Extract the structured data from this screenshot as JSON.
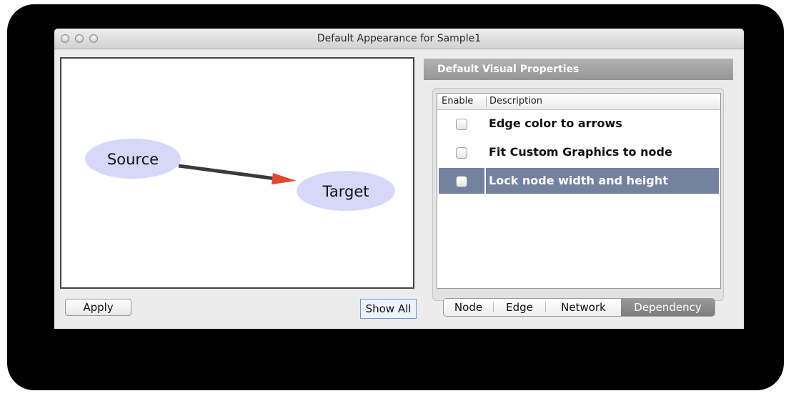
{
  "window": {
    "title": "Default Appearance for Sample1"
  },
  "network": {
    "source_label": "Source",
    "target_label": "Target",
    "colors": {
      "node_fill": "#d6d8fa",
      "edge": "#3a3a3a",
      "arrow": "#e04a33"
    }
  },
  "buttons": {
    "apply": "Apply",
    "show_all": "Show All"
  },
  "properties": {
    "header": "Default Visual Properties",
    "columns": {
      "enable": "Enable",
      "description": "Description"
    },
    "rows": [
      {
        "label": "Edge color to arrows",
        "checked": false,
        "selected": false
      },
      {
        "label": "Fit Custom Graphics to node",
        "checked": false,
        "selected": false
      },
      {
        "label": "Lock node width and height",
        "checked": false,
        "selected": true
      }
    ],
    "selected_row_color": "#7482a0"
  },
  "tabs": [
    "Node",
    "Edge",
    "Network",
    "Dependency"
  ],
  "active_tab": "Dependency"
}
